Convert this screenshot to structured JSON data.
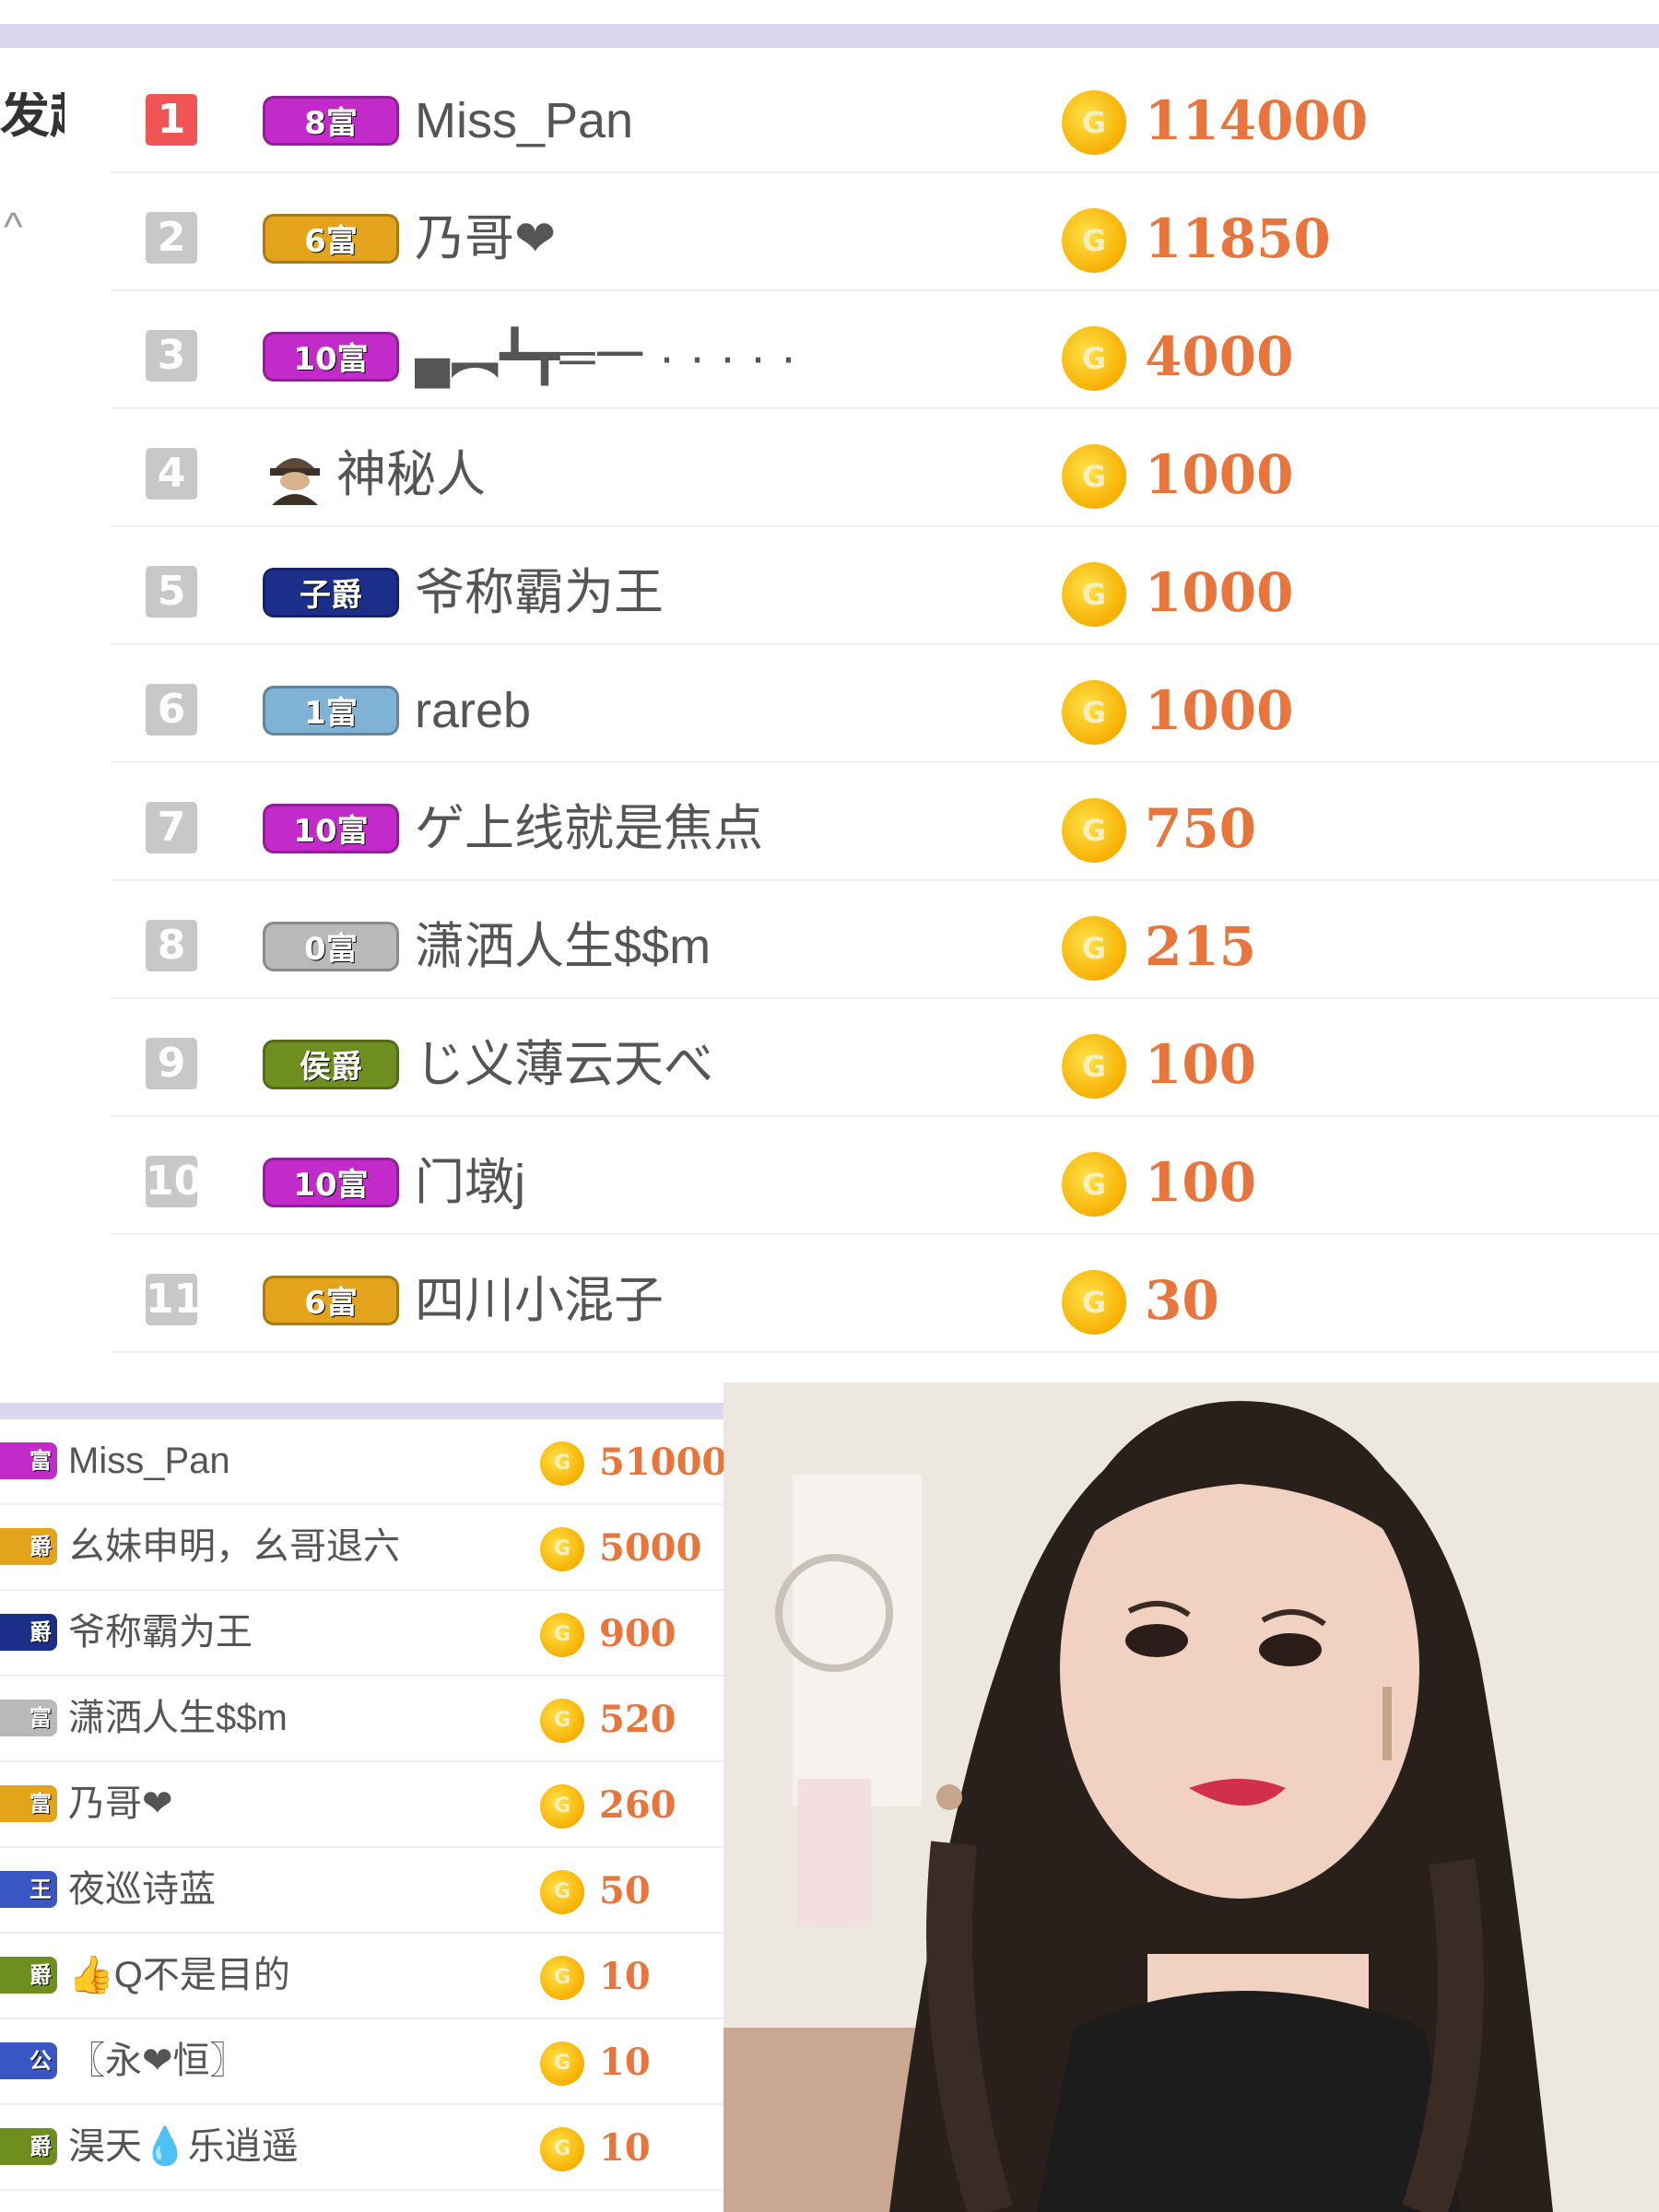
{
  "sidebar": {
    "label": "发起\n榜单",
    "caret": "^"
  },
  "coin_glyph": "G",
  "badge_colors": {
    "magenta": "#c22bc9",
    "gold": "#e3a41c",
    "navy": "#1b2f8a",
    "lightblue": "#7fb2d4",
    "gray": "#b9b9b9",
    "green": "#6e8f1f",
    "blue": "#3a55c4"
  },
  "ranking_main": [
    {
      "rank": "1",
      "badge": "8富",
      "badge_color": "magenta",
      "name": "Miss_Pan",
      "amount": "114000"
    },
    {
      "rank": "2",
      "badge": "6富",
      "badge_color": "gold",
      "name": "乃哥❤",
      "amount": "11850"
    },
    {
      "rank": "3",
      "badge": "10富",
      "badge_color": "magenta",
      "name": "▄︻┻┳═一 · · · · ·",
      "amount": "4000"
    },
    {
      "rank": "4",
      "badge": "",
      "badge_color": "",
      "name": "神秘人",
      "amount": "1000",
      "mystery": true
    },
    {
      "rank": "5",
      "badge": "子爵",
      "badge_color": "navy",
      "name": "爷称霸为王",
      "amount": "1000"
    },
    {
      "rank": "6",
      "badge": "1富",
      "badge_color": "lightblue",
      "name": "rareb",
      "amount": "1000"
    },
    {
      "rank": "7",
      "badge": "10富",
      "badge_color": "magenta",
      "name": "ゲ上线就是焦点",
      "amount": "750"
    },
    {
      "rank": "8",
      "badge": "0富",
      "badge_color": "gray",
      "name": "潇洒人生$$m",
      "amount": "215"
    },
    {
      "rank": "9",
      "badge": "侯爵",
      "badge_color": "green",
      "name": "じ义薄云天べ",
      "amount": "100"
    },
    {
      "rank": "10",
      "badge": "10富",
      "badge_color": "magenta",
      "name": "门墩j",
      "amount": "100"
    },
    {
      "rank": "11",
      "badge": "6富",
      "badge_color": "gold",
      "name": "四川小混子",
      "amount": "30"
    }
  ],
  "ranking_secondary": [
    {
      "badge": "富",
      "badge_color": "magenta",
      "name": "Miss_Pan",
      "amount": "51000"
    },
    {
      "badge": "爵",
      "badge_color": "gold",
      "name": "幺妹申明，幺哥退六",
      "amount": "5000"
    },
    {
      "badge": "爵",
      "badge_color": "navy",
      "name": "爷称霸为王",
      "amount": "900"
    },
    {
      "badge": "富",
      "badge_color": "gray",
      "name": "潇洒人生$$m",
      "amount": "520"
    },
    {
      "badge": "富",
      "badge_color": "gold",
      "name": "乃哥❤",
      "amount": "260"
    },
    {
      "badge": "王",
      "badge_color": "blue",
      "name": "夜巡诗蓝",
      "amount": "50"
    },
    {
      "badge": "爵",
      "badge_color": "green",
      "name": "👍Q不是目的",
      "amount": "10"
    },
    {
      "badge": "公",
      "badge_color": "blue",
      "name": "〖永❤恒〗",
      "amount": "10"
    },
    {
      "badge": "爵",
      "badge_color": "green",
      "name": "淏天💧乐逍遥",
      "amount": "10"
    }
  ]
}
